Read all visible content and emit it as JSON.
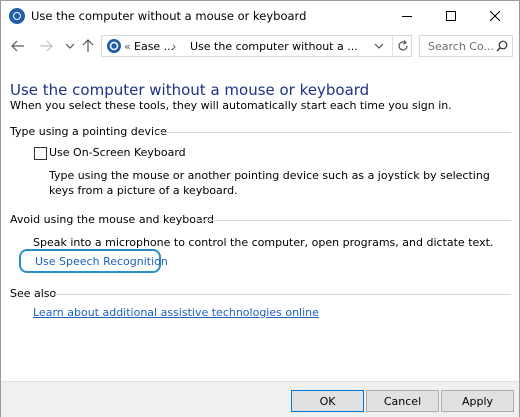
{
  "window": {
    "title": "Use the computer without a mouse or keyboard"
  },
  "address": {
    "overflow_chevron": "«",
    "crumb_1": "Ease ...",
    "separator": "›",
    "crumb_current": "Use the computer without a ..."
  },
  "search": {
    "placeholder": "Search Co..."
  },
  "main": {
    "title": "Use the computer without a mouse or keyboard",
    "subtitle": "When you select these tools, they will automatically start each time you sign in.",
    "section_pointing": {
      "heading": "Type using a pointing device",
      "checkbox_label": "Use On-Screen Keyboard",
      "checkbox_checked": false,
      "description": "Type using the mouse or another pointing device such as a joystick by selecting keys from a picture of a keyboard."
    },
    "section_avoid": {
      "heading": "Avoid using the mouse and keyboard",
      "description": "Speak into a microphone to control the computer, open programs, and dictate text.",
      "link": "Use Speech Recognition"
    },
    "section_see_also": {
      "heading": "See also",
      "link": "Learn about additional assistive technologies online"
    }
  },
  "footer": {
    "ok": "OK",
    "cancel": "Cancel",
    "apply": "Apply"
  },
  "colors": {
    "title_blue": "#1e3287",
    "link_blue": "#1f5fbd",
    "highlight_ring": "#2a8fc9"
  }
}
